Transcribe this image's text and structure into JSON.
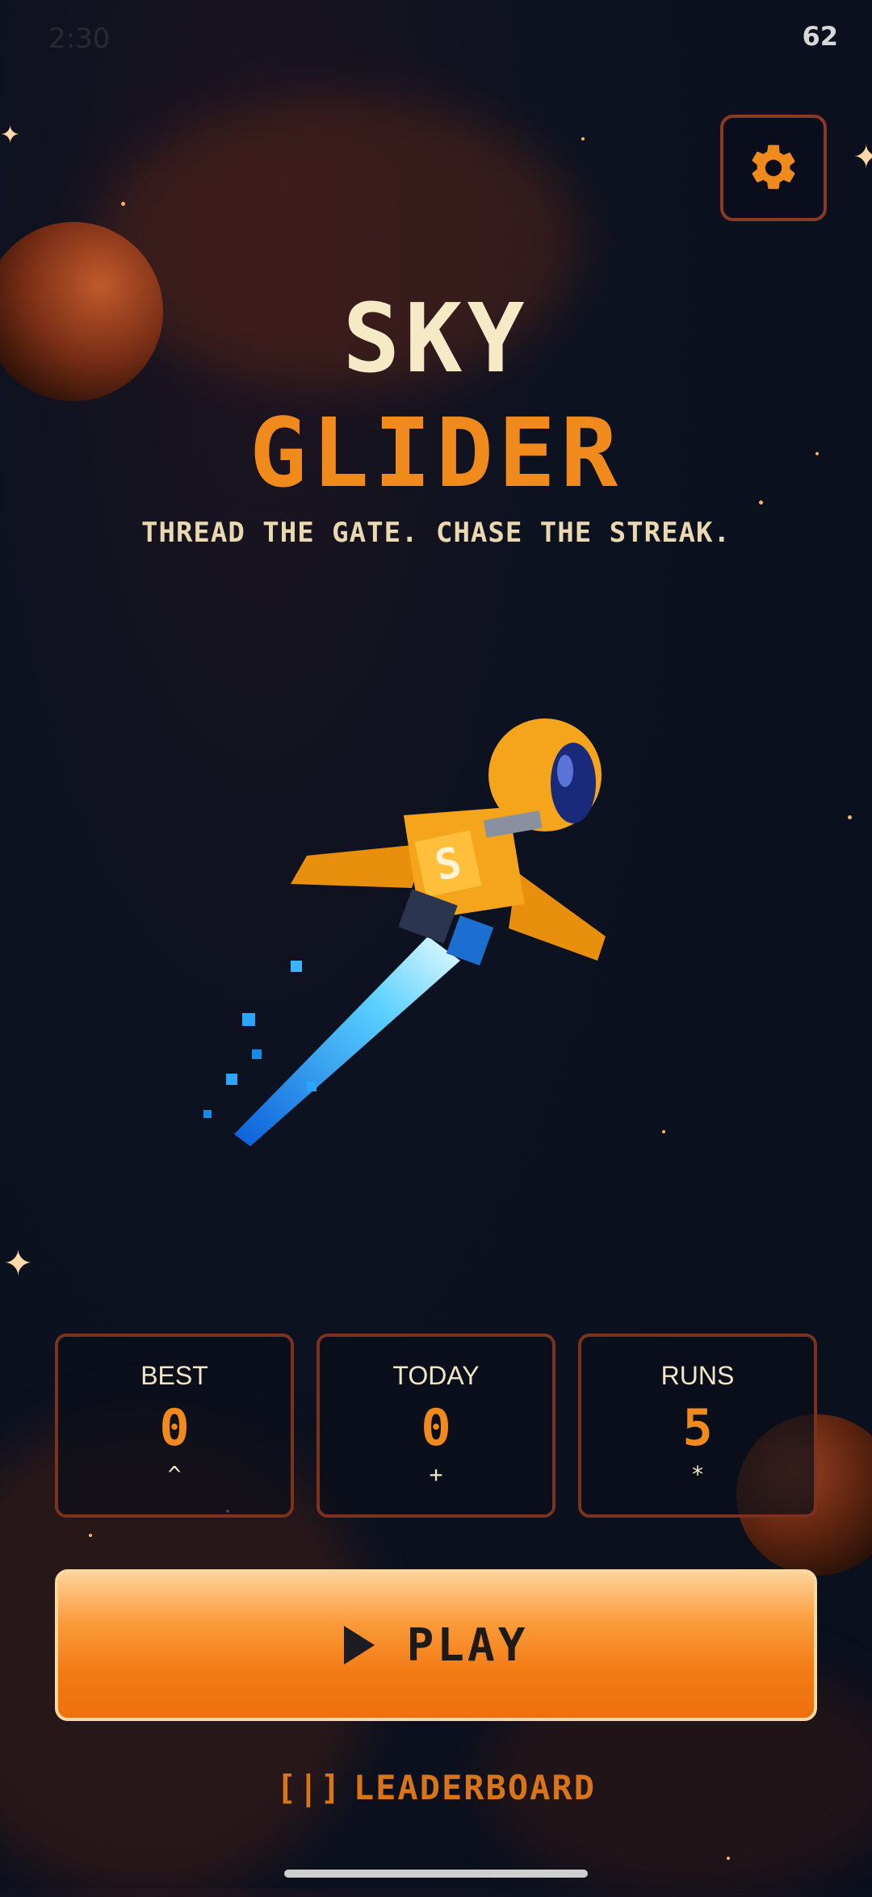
{
  "status": {
    "time": "2:30",
    "battery": "62"
  },
  "title": {
    "line1": "SKY",
    "line2": "GLIDER"
  },
  "tagline": "THREAD THE GATE. CHASE THE STREAK.",
  "character": {
    "badge": "S"
  },
  "stats": [
    {
      "label": "BEST",
      "value": "0",
      "glyph": "^"
    },
    {
      "label": "TODAY",
      "value": "0",
      "glyph": "+"
    },
    {
      "label": "RUNS",
      "value": "5",
      "glyph": "*"
    }
  ],
  "play_label": "PLAY",
  "leaderboard": {
    "icon": "[|]",
    "label": "LEADERBOARD"
  },
  "colors": {
    "accent": "#f08a1c",
    "cream": "#f5e9c6",
    "border": "#7b3320",
    "background": "#0a0f1c",
    "flame": "#1aa8ff"
  },
  "icons": {
    "settings": "gear-icon",
    "play": "play-icon",
    "leaderboard": "leaderboard-icon"
  }
}
